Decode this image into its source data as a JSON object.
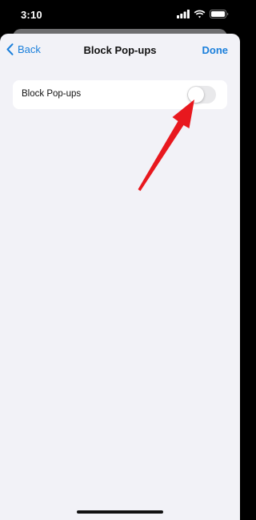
{
  "status_bar": {
    "time": "3:10"
  },
  "nav": {
    "back_label": "Back",
    "title": "Block Pop-ups",
    "done_label": "Done"
  },
  "settings": {
    "rows": [
      {
        "label": "Block Pop-ups",
        "toggle_on": false
      }
    ]
  },
  "colors": {
    "accent": "#1a7fdb",
    "background": "#f2f2f7",
    "annotation_arrow": "#e8181e"
  }
}
